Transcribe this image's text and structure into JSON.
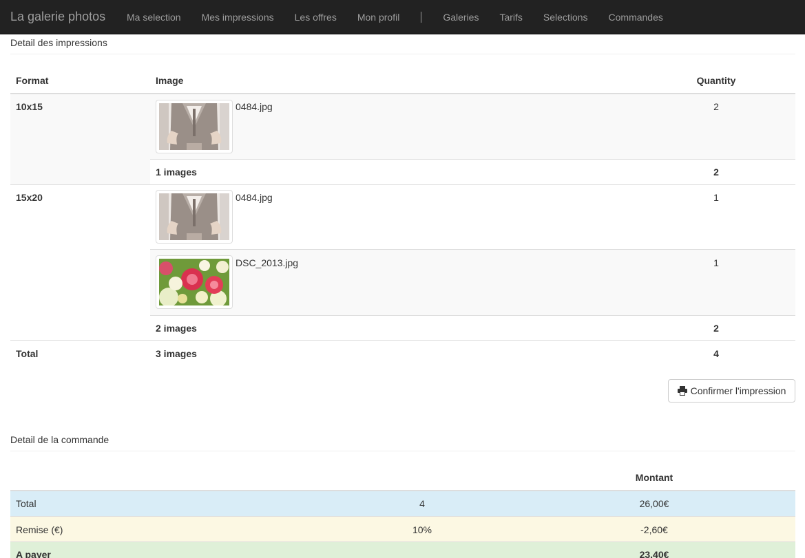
{
  "navbar": {
    "brand": "La galerie photos",
    "left_links": [
      "Ma selection",
      "Mes impressions",
      "Les offres",
      "Mon profil"
    ],
    "right_links": [
      "Galeries",
      "Tarifs",
      "Selections",
      "Commandes"
    ]
  },
  "impressions": {
    "title": "Detail des impressions",
    "headers": {
      "format": "Format",
      "image": "Image",
      "quantity": "Quantity"
    },
    "groups": [
      {
        "format": "10x15",
        "items": [
          {
            "file": "0484.jpg",
            "quantity": "2",
            "thumb_icon": "suit-photo"
          }
        ],
        "subtotal_images": "1 images",
        "subtotal_quantity": "2"
      },
      {
        "format": "15x20",
        "items": [
          {
            "file": "0484.jpg",
            "quantity": "1",
            "thumb_icon": "suit-photo"
          },
          {
            "file": "DSC_2013.jpg",
            "quantity": "1",
            "thumb_icon": "roses-photo"
          }
        ],
        "subtotal_images": "2 images",
        "subtotal_quantity": "2"
      }
    ],
    "total": {
      "label": "Total",
      "images": "3 images",
      "quantity": "4"
    },
    "confirm_button": "Confirmer l'impression"
  },
  "commande": {
    "title": "Detail de la commande",
    "headers": {
      "montant": "Montant"
    },
    "rows": [
      {
        "label": "Total",
        "mid": "4",
        "amount": "26,00€",
        "status_color": "#d9edf7"
      },
      {
        "label": "Remise (€)",
        "mid": "10%",
        "amount": "-2,60€",
        "status_color": "#fcf8e3"
      },
      {
        "label": "A payer",
        "mid": "",
        "amount": "23,40€",
        "status_color": "#dff0d8"
      }
    ]
  }
}
